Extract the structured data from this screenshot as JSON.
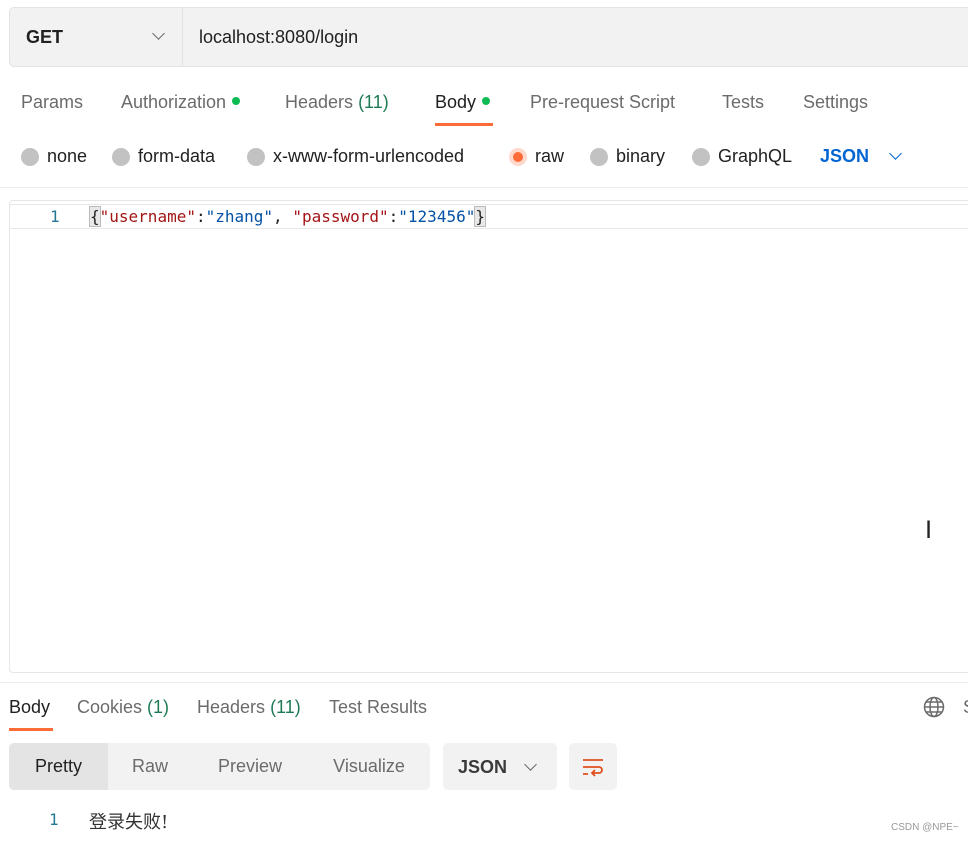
{
  "request": {
    "method": "GET",
    "url": "localhost:8080/login"
  },
  "request_tabs": [
    {
      "label": "Params"
    },
    {
      "label": "Authorization",
      "dot": true
    },
    {
      "label": "Headers",
      "count": "(11)"
    },
    {
      "label": "Body",
      "dot": true,
      "active": true
    },
    {
      "label": "Pre-request Script"
    },
    {
      "label": "Tests"
    },
    {
      "label": "Settings"
    }
  ],
  "body_types": [
    {
      "label": "none"
    },
    {
      "label": "form-data"
    },
    {
      "label": "x-www-form-urlencoded"
    },
    {
      "label": "raw",
      "selected": true
    },
    {
      "label": "binary"
    },
    {
      "label": "GraphQL"
    }
  ],
  "body_format": "JSON",
  "editor": {
    "line": "1",
    "open": "{",
    "k1": "\"username\"",
    "colon": ":",
    "v1": "\"zhang\"",
    "comma": ", ",
    "k2": "\"password\"",
    "v2": "\"123456\"",
    "close": "}"
  },
  "response_tabs": [
    {
      "label": "Body",
      "active": true
    },
    {
      "label": "Cookies",
      "count": "(1)"
    },
    {
      "label": "Headers",
      "count": "(11)"
    },
    {
      "label": "Test Results"
    }
  ],
  "response_status_partial": "S",
  "view_modes": [
    "Pretty",
    "Raw",
    "Preview",
    "Visualize"
  ],
  "response_format": "JSON",
  "response": {
    "line": "1",
    "text": "登录失败!"
  },
  "watermark": "CSDN @NPE~",
  "colors": {
    "accent": "#ff6c37",
    "dot": "#0cbb52",
    "link": "#0265d2"
  }
}
